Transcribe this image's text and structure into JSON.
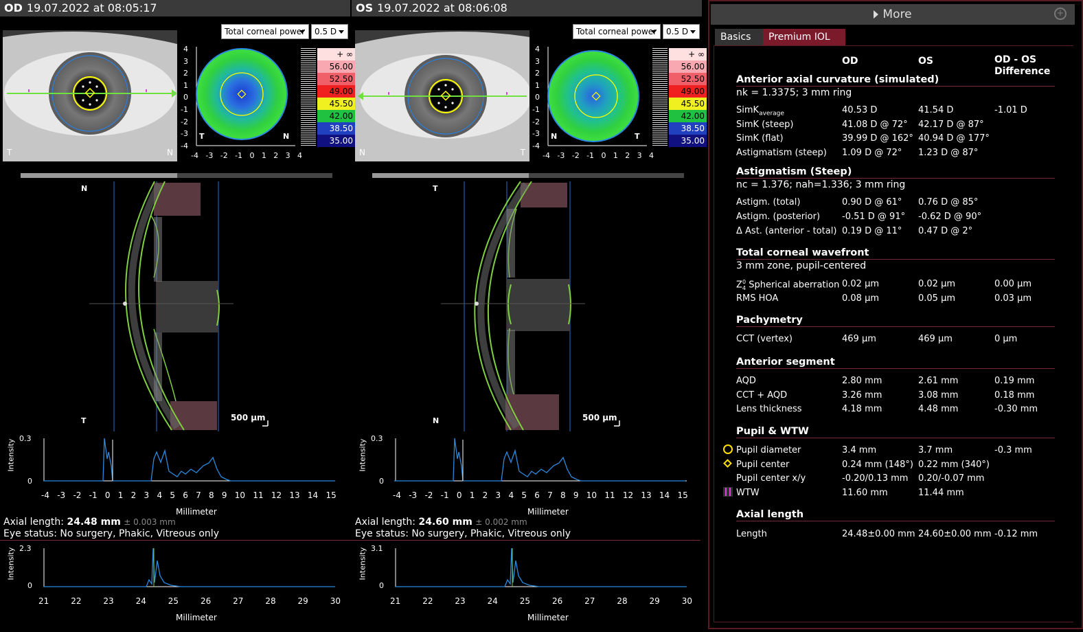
{
  "od": {
    "eye": "OD",
    "datetime": "19.07.2022 at 08:05:17",
    "map_type": "Total corneal power",
    "step": "0.5 D",
    "orientation_left": "T",
    "orientation_right": "N",
    "map_left": "T",
    "map_right": "N",
    "scheimpflug_top": "N",
    "scheimpflug_bottom": "T",
    "scale_bar": "500 µm",
    "axial_label": "Axial length:",
    "axial_value": "24.48 mm",
    "axial_tol": "± 0.003 mm",
    "eye_status": "Eye status: No surgery, Phakic, Vitreous only",
    "g1_ymax": "0.3",
    "g2_ymax": "2.3"
  },
  "os": {
    "eye": "OS",
    "datetime": "19.07.2022 at 08:06:08",
    "map_type": "Total corneal power",
    "step": "0.5 D",
    "orientation_left": "N",
    "orientation_right": "T",
    "map_left": "N",
    "map_right": "T",
    "scheimpflug_top": "T",
    "scheimpflug_bottom": "N",
    "scale_bar": "500 µm",
    "axial_label": "Axial length:",
    "axial_value": "24.60 mm",
    "axial_tol": "± 0.002 mm",
    "eye_status": "Eye status: No surgery, Phakic, Vitreous only",
    "g1_ymax": "0.3",
    "g2_ymax": "3.1"
  },
  "scale": [
    "+ ∞",
    "56.00",
    "52.50",
    "49.00",
    "45.50",
    "42.00",
    "38.50",
    "35.00"
  ],
  "scale_colors": [
    "#ffe0e0",
    "#f8a8b0",
    "#f06068",
    "#f02020",
    "#f0f020",
    "#20c040",
    "#2040c0",
    "#101080"
  ],
  "map_axis": [
    "4",
    "3",
    "2",
    "1",
    "0",
    "-1",
    "-2",
    "-3",
    "-4"
  ],
  "map_xaxis": [
    "-4",
    "-3",
    "-2",
    "-1",
    "0",
    "1",
    "2",
    "3",
    "4"
  ],
  "graph1_x": [
    "-4",
    "-3",
    "-2",
    "-1",
    "0",
    "1",
    "2",
    "3",
    "4",
    "5",
    "6",
    "7",
    "8",
    "9",
    "10",
    "11",
    "12",
    "13",
    "14",
    "15"
  ],
  "graph2_x": [
    "21",
    "22",
    "23",
    "24",
    "25",
    "26",
    "27",
    "28",
    "29",
    "30"
  ],
  "graph_xlabel": "Millimeter",
  "graph_ylabel": "Intensity",
  "graph_y0": "0",
  "right": {
    "more": "More",
    "tabs": [
      "Basics",
      "Premium IOL"
    ],
    "col_od": "OD",
    "col_os": "OS",
    "col_diff": "OD - OS\nDifference",
    "sections": {
      "s1": {
        "title": "Anterior axial curvature (simulated)",
        "sub": "nk = 1.3375; 3 mm ring"
      },
      "s2": {
        "title": "Astigmatism (Steep)",
        "sub": "nc = 1.376; nah=1.336; 3 mm ring"
      },
      "s3": {
        "title": "Total corneal wavefront",
        "sub": "3 mm zone, pupil-centered"
      },
      "s4": {
        "title": "Pachymetry"
      },
      "s5": {
        "title": "Anterior segment"
      },
      "s6": {
        "title": "Pupil & WTW"
      },
      "s7": {
        "title": "Axial length"
      }
    },
    "rows": [
      [
        "SimK average",
        "40.53 D",
        "41.54 D",
        "-1.01 D"
      ],
      [
        "SimK (steep)",
        "41.08 D @ 72°",
        "42.17 D @ 87°",
        ""
      ],
      [
        "SimK (flat)",
        "39.99 D @ 162°",
        "40.94 D @ 177°",
        ""
      ],
      [
        "Astigmatism (steep)",
        "1.09 D @ 72°",
        "1.23 D @ 87°",
        ""
      ],
      [
        "Astigm. (total)",
        "0.90 D @ 61°",
        "0.76 D @ 85°",
        ""
      ],
      [
        "Astigm. (posterior)",
        "-0.51 D @ 91°",
        "-0.62 D @ 90°",
        ""
      ],
      [
        "Δ Ast. (anterior - total)",
        "0.19 D @ 11°",
        "0.47 D @ 2°",
        ""
      ],
      [
        "Z 4 0 Spherical aberration",
        "0.02 µm",
        "0.02 µm",
        "0.00 µm"
      ],
      [
        "RMS HOA",
        "0.08 µm",
        "0.05 µm",
        "0.03 µm"
      ],
      [
        "CCT (vertex)",
        "469 µm",
        "469 µm",
        "0 µm"
      ],
      [
        "AQD",
        "2.80 mm",
        "2.61 mm",
        "0.19 mm"
      ],
      [
        "CCT + AQD",
        "3.26 mm",
        "3.08 mm",
        "0.18 mm"
      ],
      [
        "Lens thickness",
        "4.18 mm",
        "4.48 mm",
        "-0.30 mm"
      ],
      [
        "Pupil diameter",
        "3.4 mm",
        "3.7 mm",
        "-0.3 mm"
      ],
      [
        "Pupil center",
        "0.24 mm (148°)",
        "0.22 mm (340°)",
        ""
      ],
      [
        "Pupil center x/y",
        "-0.20/0.13 mm",
        "0.20/-0.07 mm",
        ""
      ],
      [
        "WTW",
        "11.60 mm",
        "11.44 mm",
        ""
      ],
      [
        "Length",
        "24.48±0.00 mm",
        "24.60±0.00 mm",
        "-0.12 mm"
      ]
    ]
  }
}
